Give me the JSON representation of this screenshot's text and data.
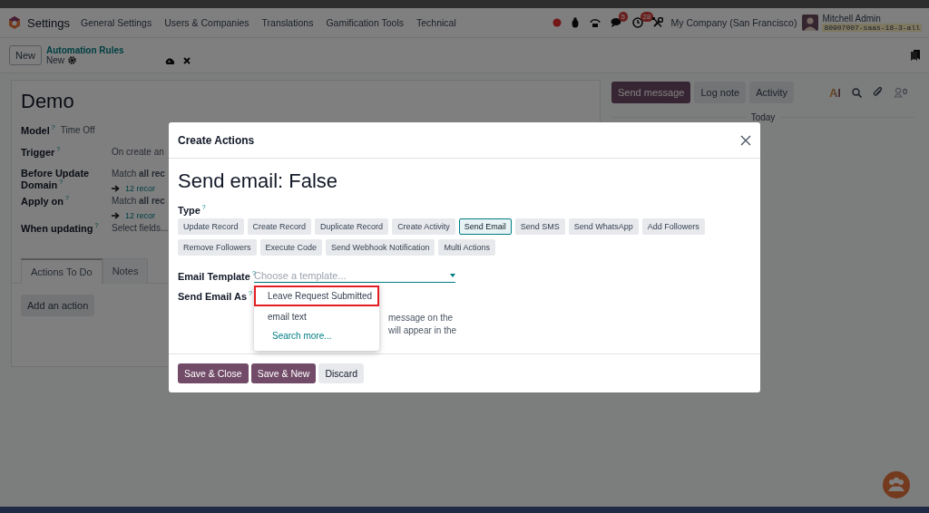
{
  "navbar": {
    "app": "Settings",
    "menus": [
      "General Settings",
      "Users & Companies",
      "Translations",
      "Gamification Tools",
      "Technical"
    ],
    "messages_badge": "5",
    "activities_badge": "28",
    "company": "My Company (San Francisco)",
    "user": {
      "name": "Mitchell Admin",
      "database": "80907007-saas-18-3-all"
    }
  },
  "control_panel": {
    "new_button": "New",
    "breadcrumb": "Automation Rules",
    "record": "New"
  },
  "form": {
    "title": "Demo",
    "fields": [
      {
        "kind": "inline",
        "label": "Model",
        "help": "?",
        "value": "Time Off"
      },
      {
        "kind": "row",
        "label": "Trigger",
        "help": "?",
        "value": "On create an"
      },
      {
        "kind": "row",
        "label": "Before Update Domain",
        "help": "?",
        "value": "Match **all rec**",
        "link": "12 recor"
      },
      {
        "kind": "row",
        "label": "Apply on",
        "help": "?",
        "value": "Match **all rec**",
        "link": "12 recor"
      },
      {
        "kind": "row",
        "label": "When updating",
        "help": "?",
        "placeholder": "Select fields..."
      }
    ],
    "tabs": [
      {
        "label": "Actions To Do",
        "selected": true
      },
      {
        "label": "Notes",
        "selected": false
      }
    ],
    "add_button": "Add an action"
  },
  "chatter": {
    "buttons": [
      {
        "label": "Send message",
        "kind": "primary"
      },
      {
        "label": "Log note",
        "kind": "secondary"
      },
      {
        "label": "Activity",
        "kind": "secondary"
      }
    ],
    "ai_label": "AI",
    "follower_count": "0",
    "date_separator": "Today"
  },
  "dialog": {
    "title": "Create Actions",
    "heading": "Send email: False",
    "type_label": "Type",
    "type_help": "?",
    "types": [
      {
        "label": "Update Record",
        "selected": false
      },
      {
        "label": "Create Record",
        "selected": false
      },
      {
        "label": "Duplicate Record",
        "selected": false
      },
      {
        "label": "Create Activity",
        "selected": false
      },
      {
        "label": "Send Email",
        "selected": true
      },
      {
        "label": "Send SMS",
        "selected": false
      },
      {
        "label": "Send WhatsApp",
        "selected": false
      },
      {
        "label": "Add Followers",
        "selected": false
      },
      {
        "label": "Remove Followers",
        "selected": false
      },
      {
        "label": "Execute Code",
        "selected": false
      },
      {
        "label": "Send Webhook Notification",
        "selected": false
      },
      {
        "label": "Multi Actions",
        "selected": false
      }
    ],
    "template_label": "Email Template",
    "template_help": "?",
    "template_placeholder": "Choose a template...",
    "send_as_label": "Send Email As",
    "send_as_help": "?",
    "send_as_text": [
      "message on the",
      "will appear in the"
    ],
    "template_options": [
      {
        "label": "Leave Request Submitted",
        "kind": "option",
        "highlighted": true
      },
      {
        "label": "email text",
        "kind": "option",
        "highlighted": false
      },
      {
        "label": "Search more...",
        "kind": "link",
        "highlighted": false
      }
    ],
    "footer_buttons": [
      {
        "label": "Save & Close",
        "kind": "primary"
      },
      {
        "label": "Save & New",
        "kind": "primary"
      },
      {
        "label": "Discard",
        "kind": "secondary"
      }
    ]
  }
}
